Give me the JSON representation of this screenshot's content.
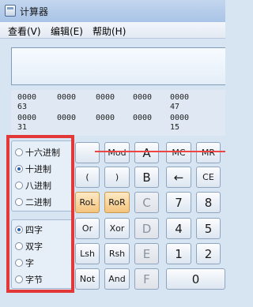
{
  "window": {
    "title": "计算器"
  },
  "menu": {
    "view": "查看(V)",
    "edit": "编辑(E)",
    "help": "帮助(H)"
  },
  "display": {
    "value": ""
  },
  "bits": {
    "row1": [
      "0000",
      "0000",
      "0000",
      "0000",
      "0000"
    ],
    "row1_labels": [
      "63",
      "47"
    ],
    "row2": [
      "0000",
      "0000",
      "0000",
      "0000",
      "0000"
    ],
    "row2_labels": [
      "31",
      "15"
    ]
  },
  "radix": [
    "十六进制",
    "十进制",
    "八进制",
    "二进制"
  ],
  "radix_selected": "十进制",
  "word": [
    "四字",
    "双字",
    "字",
    "字节"
  ],
  "word_selected": "四字",
  "keys": {
    "blank1": "",
    "mod": "Mod",
    "a": "A",
    "mc": "MC",
    "mr": "MR",
    "lparen": "(",
    "rparen": ")",
    "b": "B",
    "back": "←",
    "ce": "CE",
    "rol": "RoL",
    "ror": "RoR",
    "c": "C",
    "k7": "7",
    "k8": "8",
    "or": "Or",
    "xor": "Xor",
    "d": "D",
    "k4": "4",
    "k5": "5",
    "lsh": "Lsh",
    "rsh": "Rsh",
    "e": "E",
    "k1": "1",
    "k2": "2",
    "not": "Not",
    "and": "And",
    "f": "F",
    "k0": "0"
  }
}
